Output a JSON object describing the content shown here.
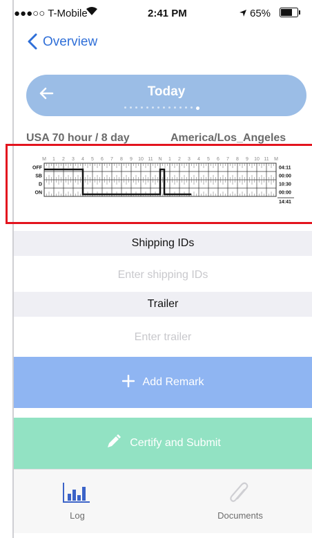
{
  "status_bar": {
    "carrier": "●●●○○ T-Mobile",
    "time": "2:41 PM",
    "battery": "65%"
  },
  "nav": {
    "back_label": "Overview"
  },
  "day_banner": {
    "title": "Today",
    "page_dots_count": 14,
    "active_dot_index": 13
  },
  "rule_info": {
    "cycle": "USA 70 hour / 8 day",
    "timezone": "America/Los_Angeles"
  },
  "log_graph": {
    "hour_labels": [
      "M",
      "1",
      "2",
      "3",
      "4",
      "5",
      "6",
      "7",
      "8",
      "9",
      "10",
      "11",
      "N",
      "1",
      "2",
      "3",
      "4",
      "5",
      "6",
      "7",
      "8",
      "9",
      "10",
      "11",
      "M"
    ],
    "rows": [
      {
        "label": "OFF",
        "total": "04:11"
      },
      {
        "label": "SB",
        "total": "00:00"
      },
      {
        "label": "D",
        "total": "10:30"
      },
      {
        "label": "ON",
        "total": "00:00"
      }
    ],
    "grand_total": "14:41"
  },
  "shipping": {
    "header": "Shipping IDs",
    "placeholder": "Enter shipping IDs"
  },
  "trailer": {
    "header": "Trailer",
    "placeholder": "Enter trailer"
  },
  "actions": {
    "add_remark": "Add Remark",
    "certify": "Certify and Submit"
  },
  "tabbar": {
    "log": "Log",
    "documents": "Documents"
  },
  "colors": {
    "accent": "#2f6fd8",
    "banner": "#9bbde6",
    "remark_button": "#8fb5f2",
    "certify_button": "#92e2c3",
    "highlight": "#e3141e"
  }
}
